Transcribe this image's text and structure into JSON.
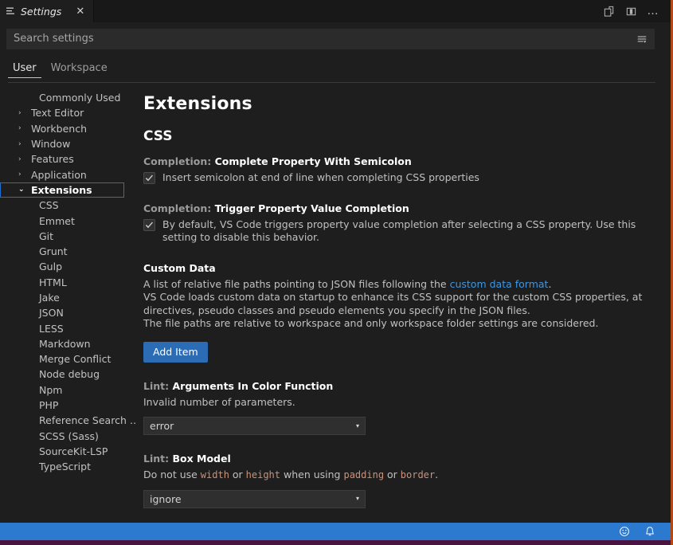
{
  "window": {
    "tab": {
      "label": "Settings",
      "icon": "settings-list-icon",
      "close_icon": "close-icon"
    },
    "actions": [
      {
        "name": "split-editor-icon",
        "title": "Split Editor"
      },
      {
        "name": "toggle-panel-icon",
        "title": "Toggle Panel Layout"
      },
      {
        "name": "more-actions-icon",
        "title": "More Actions...",
        "glyph": "…"
      }
    ]
  },
  "search": {
    "placeholder": "Search settings",
    "value": "",
    "filter_icon": "filter-icon"
  },
  "scope_tabs": [
    {
      "label": "User",
      "active": true
    },
    {
      "label": "Workspace",
      "active": false
    }
  ],
  "toc": {
    "items": [
      {
        "label": "Commonly Used",
        "type": "leaf",
        "selected": false
      },
      {
        "label": "Text Editor",
        "type": "collapsed",
        "selected": false
      },
      {
        "label": "Workbench",
        "type": "collapsed",
        "selected": false
      },
      {
        "label": "Window",
        "type": "collapsed",
        "selected": false
      },
      {
        "label": "Features",
        "type": "collapsed",
        "selected": false
      },
      {
        "label": "Application",
        "type": "collapsed",
        "selected": false
      },
      {
        "label": "Extensions",
        "type": "expanded",
        "selected": true
      },
      {
        "label": "CSS",
        "type": "child",
        "selected": false
      },
      {
        "label": "Emmet",
        "type": "child",
        "selected": false
      },
      {
        "label": "Git",
        "type": "child",
        "selected": false
      },
      {
        "label": "Grunt",
        "type": "child",
        "selected": false
      },
      {
        "label": "Gulp",
        "type": "child",
        "selected": false
      },
      {
        "label": "HTML",
        "type": "child",
        "selected": false
      },
      {
        "label": "Jake",
        "type": "child",
        "selected": false
      },
      {
        "label": "JSON",
        "type": "child",
        "selected": false
      },
      {
        "label": "LESS",
        "type": "child",
        "selected": false
      },
      {
        "label": "Markdown",
        "type": "child",
        "selected": false
      },
      {
        "label": "Merge Conflict",
        "type": "child",
        "selected": false
      },
      {
        "label": "Node debug",
        "type": "child",
        "selected": false
      },
      {
        "label": "Npm",
        "type": "child",
        "selected": false
      },
      {
        "label": "PHP",
        "type": "child",
        "selected": false
      },
      {
        "label": "Reference Search …",
        "type": "child",
        "selected": false
      },
      {
        "label": "SCSS (Sass)",
        "type": "child",
        "selected": false
      },
      {
        "label": "SourceKit-LSP",
        "type": "child",
        "selected": false
      },
      {
        "label": "TypeScript",
        "type": "child",
        "selected": false
      }
    ],
    "chevron_collapsed": "›",
    "chevron_expanded": "⌄"
  },
  "content": {
    "heading": "Extensions",
    "subheading": "CSS",
    "settings": {
      "complete_property_semicolon": {
        "prefix": "Completion: ",
        "title": "Complete Property With Semicolon",
        "description": "Insert semicolon at end of line when completing CSS properties",
        "checked": true
      },
      "trigger_property_value": {
        "prefix": "Completion: ",
        "title": "Trigger Property Value Completion",
        "description": "By default, VS Code triggers property value completion after selecting a CSS property. Use this setting to disable this behavior.",
        "checked": true
      },
      "custom_data": {
        "title": "Custom Data",
        "desc_line1_a": "A list of relative file paths pointing to JSON files following the ",
        "desc_link": "custom data format",
        "desc_line1_b": ".",
        "desc_line2": "VS Code loads custom data on startup to enhance its CSS support for the custom CSS properties, at directives, pseudo classes and pseudo elements you specify in the JSON files.",
        "desc_line3": "The file paths are relative to workspace and only workspace folder settings are considered.",
        "button_label": "Add Item"
      },
      "arguments_in_color_function": {
        "prefix": "Lint: ",
        "title": "Arguments In Color Function",
        "description": "Invalid number of parameters.",
        "value": "error"
      },
      "box_model": {
        "prefix": "Lint: ",
        "title": "Box Model",
        "desc_a": "Do not use ",
        "code1": "width",
        "desc_b": " or ",
        "code2": "height",
        "desc_c": " when using ",
        "code3": "padding",
        "desc_d": " or ",
        "code4": "border",
        "desc_e": ".",
        "value": "ignore"
      }
    },
    "select_arrow": "▾"
  },
  "statusbar": {
    "items": [
      {
        "name": "feedback-smiley-icon"
      },
      {
        "name": "notifications-bell-icon"
      }
    ]
  },
  "colors": {
    "accent_blue": "#2c7ad0",
    "button_blue": "#2b6cb4",
    "link_blue": "#3f96e0",
    "selection_border": "#1f6fd0",
    "code_token": "#ce9178",
    "window_edge": "#b24a16",
    "underbar": "#4a1340"
  }
}
